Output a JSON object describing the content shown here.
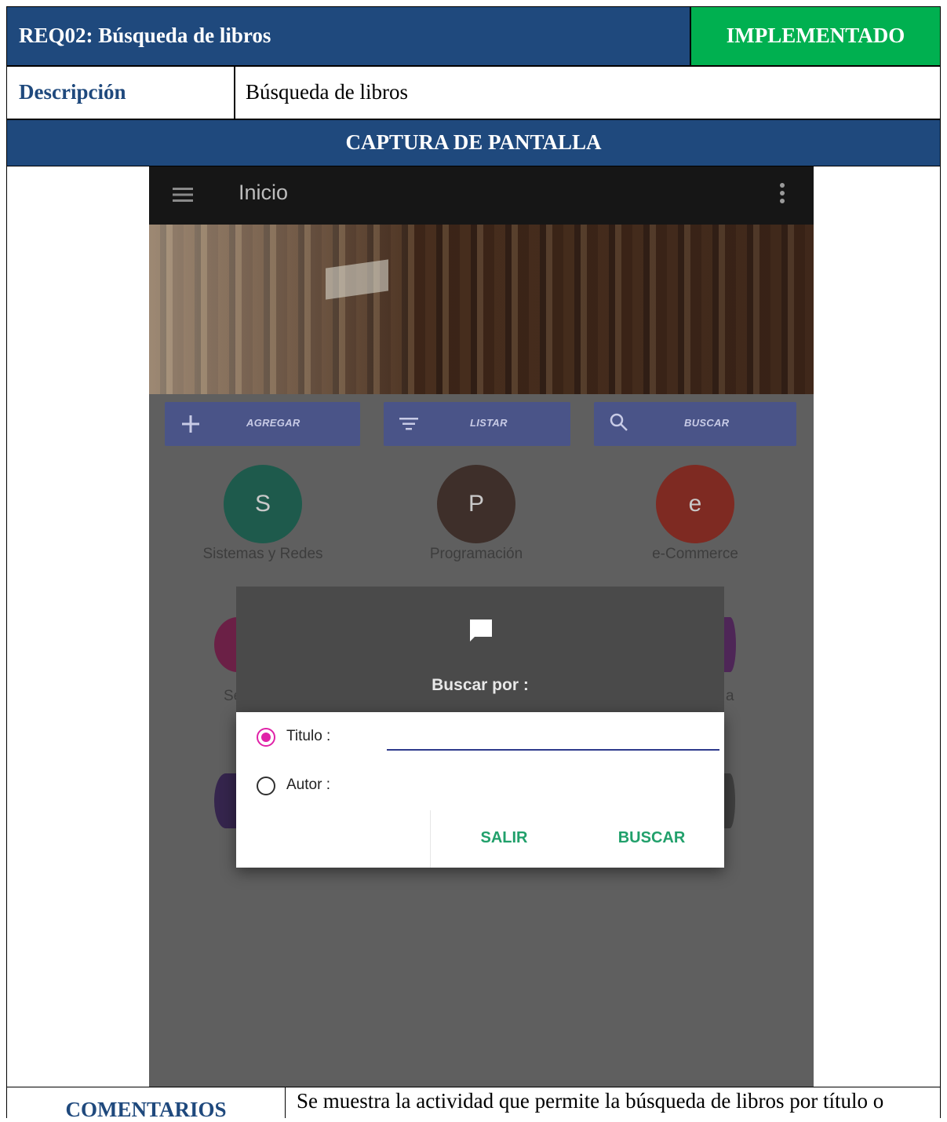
{
  "requirement": {
    "title": "REQ02: Búsqueda de libros",
    "status": "IMPLEMENTADO",
    "colors": {
      "header_blue": "#1f497d",
      "status_green": "#00b050"
    }
  },
  "description": {
    "label": "Descripción",
    "value": "Búsqueda de libros"
  },
  "capture": {
    "label": "CAPTURA DE PANTALLA"
  },
  "app": {
    "menu_icon": "hamburger-menu-icon",
    "title": "Inicio",
    "overflow_icon": "overflow-menu-icon",
    "actions": [
      {
        "icon": "plus-icon",
        "label": "AGREGAR"
      },
      {
        "icon": "filter-list-icon",
        "label": "LISTAR"
      },
      {
        "icon": "search-icon",
        "label": "BUSCAR"
      }
    ],
    "categories": [
      {
        "letter": "S",
        "label": "Sistemas y Redes",
        "color": "#1e5a4c"
      },
      {
        "letter": "P",
        "label": "Programación",
        "color": "#3e2f2a"
      },
      {
        "letter": "e",
        "label": "e-Commerce",
        "color": "#7e2a22"
      }
    ],
    "partial_labels": {
      "left": "Se",
      "right": "a"
    }
  },
  "dialog": {
    "icon": "message-icon",
    "title": "Buscar por :",
    "options": [
      {
        "label": "Titulo :",
        "selected": true
      },
      {
        "label": "Autor :",
        "selected": false
      }
    ],
    "input_value": "",
    "accent": "#e022a8",
    "buttons": {
      "cancel": "SALIR",
      "confirm": "BUSCAR"
    }
  },
  "comments": {
    "label": "COMENTARIOS",
    "text": "Se muestra la actividad que permite la búsqueda de libros por título o autor."
  }
}
